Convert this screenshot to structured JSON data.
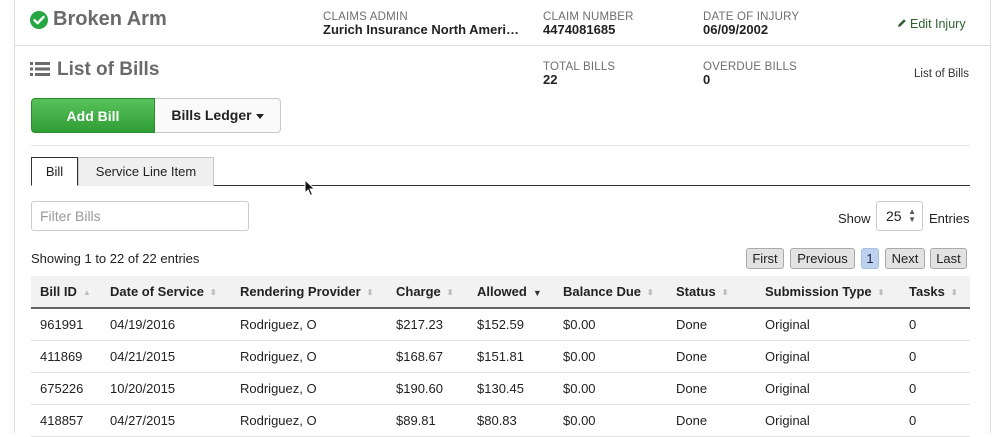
{
  "header": {
    "claim_title": "Broken Arm",
    "claims_admin_label": "CLAIMS ADMIN",
    "claims_admin_value": "Zurich Insurance North Ameri…",
    "claim_number_label": "CLAIM NUMBER",
    "claim_number_value": "4474081685",
    "date_of_injury_label": "DATE OF INJURY",
    "date_of_injury_value": "06/09/2002",
    "edit_injury": "Edit Injury",
    "check_color": "#27a744"
  },
  "section": {
    "title": "List of Bills",
    "total_bills_label": "TOTAL BILLS",
    "total_bills_value": "22",
    "overdue_bills_label": "OVERDUE BILLS",
    "overdue_bills_value": "0",
    "breadcrumb": "List of Bills"
  },
  "actions": {
    "add_bill": "Add Bill",
    "bills_ledger": "Bills Ledger",
    "add_color": "#2f9e34"
  },
  "tabs": [
    {
      "label": "Bill",
      "active": true
    },
    {
      "label": "Service Line Item",
      "active": false
    }
  ],
  "filter": {
    "placeholder": "Filter Bills"
  },
  "page_size": {
    "show_label": "Show",
    "value": "25",
    "entries_label": "Entries"
  },
  "showing": "Showing 1 to 22 of 22 entries",
  "pagination": {
    "first": "First",
    "previous": "Previous",
    "current": "1",
    "next": "Next",
    "last": "Last"
  },
  "table": {
    "columns": [
      "Bill ID",
      "Date of Service",
      "Rendering Provider",
      "Charge",
      "Allowed",
      "Balance Due",
      "Status",
      "Submission Type",
      "Tasks"
    ],
    "sorted_column": "Allowed",
    "sort_direction": "descending",
    "rows": [
      [
        "961991",
        "04/19/2016",
        "Rodriguez, O",
        "$217.23",
        "$152.59",
        "$0.00",
        "Done",
        "Original",
        "0"
      ],
      [
        "411869",
        "04/21/2015",
        "Rodriguez, O",
        "$168.67",
        "$151.81",
        "$0.00",
        "Done",
        "Original",
        "0"
      ],
      [
        "675226",
        "10/20/2015",
        "Rodriguez, O",
        "$190.60",
        "$130.45",
        "$0.00",
        "Done",
        "Original",
        "0"
      ],
      [
        "418857",
        "04/27/2015",
        "Rodriguez, O",
        "$89.81",
        "$80.83",
        "$0.00",
        "Done",
        "Original",
        "0"
      ]
    ]
  }
}
